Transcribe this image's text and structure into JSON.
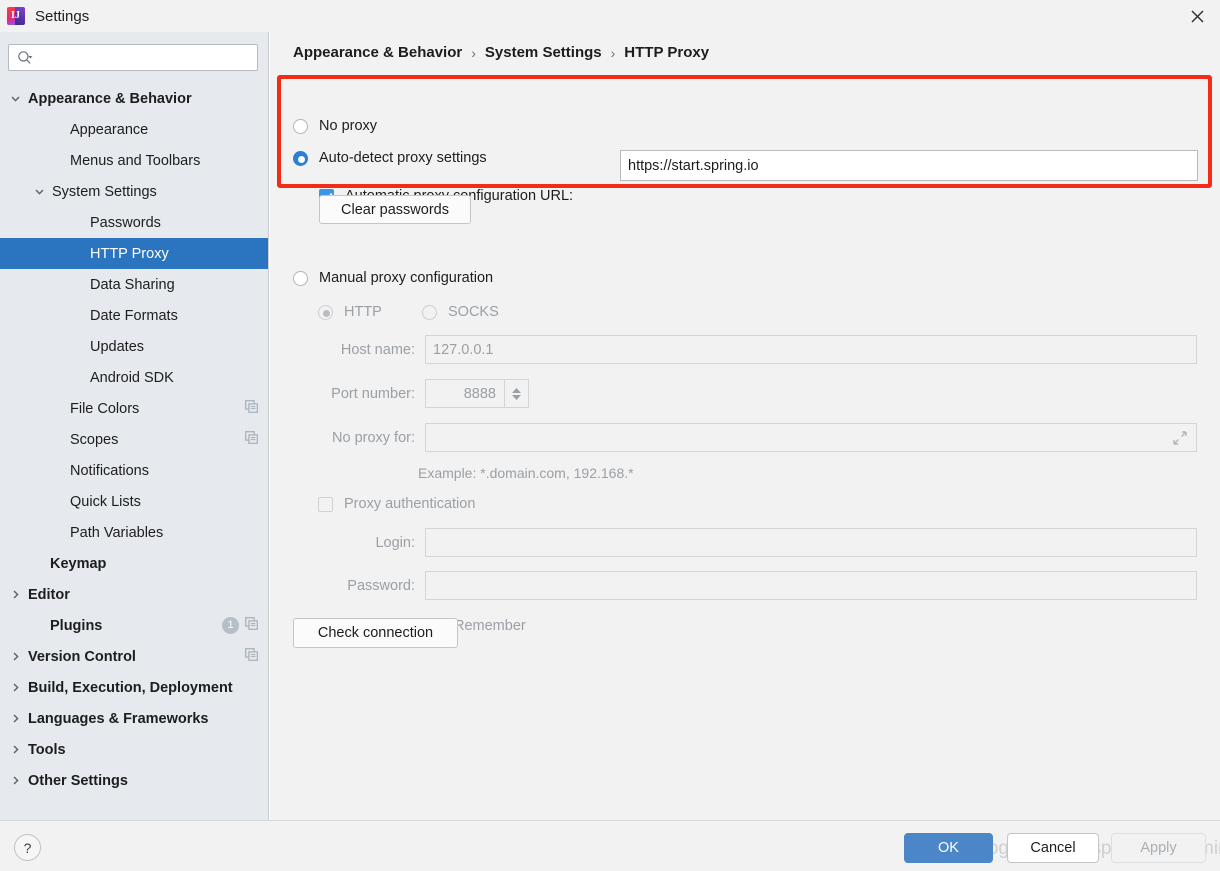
{
  "window": {
    "title": "Settings",
    "logo_letter": "IJ",
    "close_icon": "close-icon"
  },
  "sidebar": {
    "search": {
      "value": "",
      "placeholder": "",
      "icon": "search-icon"
    },
    "items": [
      {
        "label": "Appearance & Behavior",
        "indent": 8,
        "bold": true,
        "twisty": "down",
        "selected": false,
        "copy": false,
        "badge": ""
      },
      {
        "label": "Appearance",
        "indent": 50,
        "bold": false,
        "twisty": "none",
        "selected": false,
        "copy": false,
        "badge": ""
      },
      {
        "label": "Menus and Toolbars",
        "indent": 50,
        "bold": false,
        "twisty": "none",
        "selected": false,
        "copy": false,
        "badge": ""
      },
      {
        "label": "System Settings",
        "indent": 32,
        "bold": false,
        "twisty": "down",
        "selected": false,
        "copy": false,
        "badge": ""
      },
      {
        "label": "Passwords",
        "indent": 70,
        "bold": false,
        "twisty": "none",
        "selected": false,
        "copy": false,
        "badge": ""
      },
      {
        "label": "HTTP Proxy",
        "indent": 70,
        "bold": false,
        "twisty": "none",
        "selected": true,
        "copy": false,
        "badge": ""
      },
      {
        "label": "Data Sharing",
        "indent": 70,
        "bold": false,
        "twisty": "none",
        "selected": false,
        "copy": false,
        "badge": ""
      },
      {
        "label": "Date Formats",
        "indent": 70,
        "bold": false,
        "twisty": "none",
        "selected": false,
        "copy": false,
        "badge": ""
      },
      {
        "label": "Updates",
        "indent": 70,
        "bold": false,
        "twisty": "none",
        "selected": false,
        "copy": false,
        "badge": ""
      },
      {
        "label": "Android SDK",
        "indent": 70,
        "bold": false,
        "twisty": "none",
        "selected": false,
        "copy": false,
        "badge": ""
      },
      {
        "label": "File Colors",
        "indent": 50,
        "bold": false,
        "twisty": "none",
        "selected": false,
        "copy": true,
        "badge": ""
      },
      {
        "label": "Scopes",
        "indent": 50,
        "bold": false,
        "twisty": "none",
        "selected": false,
        "copy": true,
        "badge": ""
      },
      {
        "label": "Notifications",
        "indent": 50,
        "bold": false,
        "twisty": "none",
        "selected": false,
        "copy": false,
        "badge": ""
      },
      {
        "label": "Quick Lists",
        "indent": 50,
        "bold": false,
        "twisty": "none",
        "selected": false,
        "copy": false,
        "badge": ""
      },
      {
        "label": "Path Variables",
        "indent": 50,
        "bold": false,
        "twisty": "none",
        "selected": false,
        "copy": false,
        "badge": ""
      },
      {
        "label": "Keymap",
        "indent": 30,
        "bold": true,
        "twisty": "none",
        "selected": false,
        "copy": false,
        "badge": ""
      },
      {
        "label": "Editor",
        "indent": 8,
        "bold": true,
        "twisty": "right",
        "selected": false,
        "copy": false,
        "badge": ""
      },
      {
        "label": "Plugins",
        "indent": 30,
        "bold": true,
        "twisty": "none",
        "selected": false,
        "copy": true,
        "badge": "1"
      },
      {
        "label": "Version Control",
        "indent": 8,
        "bold": true,
        "twisty": "right",
        "selected": false,
        "copy": true,
        "badge": ""
      },
      {
        "label": "Build, Execution, Deployment",
        "indent": 8,
        "bold": true,
        "twisty": "right",
        "selected": false,
        "copy": false,
        "badge": ""
      },
      {
        "label": "Languages & Frameworks",
        "indent": 8,
        "bold": true,
        "twisty": "right",
        "selected": false,
        "copy": false,
        "badge": ""
      },
      {
        "label": "Tools",
        "indent": 8,
        "bold": true,
        "twisty": "right",
        "selected": false,
        "copy": false,
        "badge": ""
      },
      {
        "label": "Other Settings",
        "indent": 8,
        "bold": true,
        "twisty": "right",
        "selected": false,
        "copy": false,
        "badge": ""
      }
    ]
  },
  "breadcrumb": {
    "separator": "›",
    "parts": [
      "Appearance & Behavior",
      "System Settings",
      "HTTP Proxy"
    ]
  },
  "proxy": {
    "no_proxy_label": "No proxy",
    "auto_detect_label": "Auto-detect proxy settings",
    "pac_label": "Automatic proxy configuration URL:",
    "pac_url_value": "https://start.spring.io",
    "clear_passwords_label": "Clear passwords",
    "manual_label": "Manual proxy configuration",
    "http_label": "HTTP",
    "socks_label": "SOCKS",
    "host_label": "Host name:",
    "host_value": "127.0.0.1",
    "port_label": "Port number:",
    "port_value": "8888",
    "no_proxy_for_label": "No proxy for:",
    "no_proxy_for_value": "",
    "example_hint": "Example: *.domain.com, 192.168.*",
    "proxy_auth_label": "Proxy authentication",
    "login_label": "Login:",
    "login_value": "",
    "password_label": "Password:",
    "password_value": "",
    "remember_label": "Remember",
    "check_connection_label": "Check connection",
    "expand_icon": "expand-icon"
  },
  "footer": {
    "help_label": "?",
    "ok_label": "OK",
    "cancel_label": "Cancel",
    "apply_label": "Apply",
    "watermark": "https://blog.csdn.net/spring_is_pyming"
  },
  "colors": {
    "selection_blue": "#2b74c0",
    "accent_blue": "#2b7fd4",
    "ok_button": "#4a86c8",
    "highlight_red": "#f22c16",
    "sidebar_bg": "#e6eaee",
    "panel_bg": "#f2f2f2"
  }
}
